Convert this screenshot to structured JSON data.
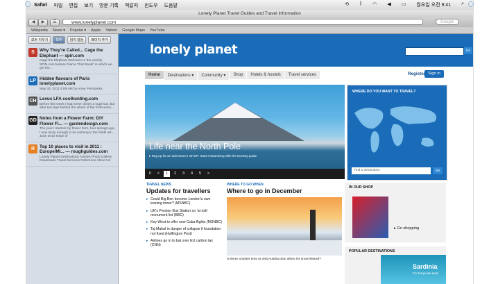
{
  "menubar": {
    "app": "Safari",
    "items": [
      "파일",
      "편집",
      "보기",
      "방문 기록",
      "책갈피",
      "윈도우",
      "도움말"
    ],
    "clock": "월요일 오전 9:41"
  },
  "window": {
    "title": "Lonely Planet Travel Guides and Travel Information"
  },
  "toolbar": {
    "url": "www.lonelyplanet.com",
    "search_placeholder": "Google"
  },
  "bookmarks": [
    "Wikipedia",
    "News ▾",
    "Popular ▾",
    "Apple",
    "Yahoo!",
    "Google Maps",
    "YouTube"
  ],
  "sidebar": {
    "tabs": [
      {
        "label": "모두 지우기"
      },
      {
        "label": "모두",
        "active": true
      },
      {
        "label": "읽지 않음"
      },
      {
        "label": "페이지 추가"
      }
    ],
    "items": [
      {
        "title": "Why They're Called... Cage the Elephant — spin.com",
        "desc": "Cage the Elephant Welcome to the weekly SPIN.com feature 'Name That Band!' in which we get the...",
        "thumb": "S",
        "color": "#c0392b"
      },
      {
        "title": "Hidden flavours of Paris lonelyplanet.com",
        "desc": "May 30, 2011 5:09 AM by Anne Petrolanka",
        "thumb": "LP",
        "color": "#1a6cb8"
      },
      {
        "title": "Lexus LFA coolhunting.com",
        "desc": "Before this week I had never driven a supercar, but after two laps behind the wheel of the forthcomin...",
        "thumb": "CH",
        "color": "#555"
      },
      {
        "title": "Notes from a Flower Farm: DIY Flower Fi... — gardendesign.com",
        "desc": "The year I started my flower farm, four springs ago, I was lucky enough to be working in the fields wit... June 2010 Issue of",
        "thumb": "GD",
        "color": "#222"
      },
      {
        "title": "Top 10 places to visit in 2011 : Europe/Mi... — roughguides.com",
        "desc": "Lonely Planet Destinations Articles Photo Gallery Downloads Travel Services Reference About Us",
        "thumb": "R",
        "color": "#e67e22"
      }
    ]
  },
  "site": {
    "logo": "lonely planet",
    "go": "Go",
    "nav": [
      "Home",
      "Destinations ▾",
      "Community ▾",
      "Shop",
      "Hotels & hostels",
      "Travel services"
    ],
    "register": "Register",
    "signin": "Sign in",
    "hero": {
      "title": "Life near the North Pole",
      "links": "▸ Rug up for an adventure   ▸ SHOP: Start researching with the Norway guide",
      "pages": [
        "II",
        "<",
        "1",
        "2",
        "3",
        "4",
        "5",
        ">"
      ]
    },
    "map": {
      "title": "WHERE DO YOU WANT TO TRAVEL?",
      "placeholder": "Find a destination",
      "go": "Go"
    },
    "news": {
      "tag": "TRAVEL NEWS",
      "title": "Updates for travellers",
      "items": [
        "Could Big Ben become London's own leaning tower? (MSNBC)",
        "UK's Preston Bus Station on 'at risk' monument list (BBC)",
        "Key West to offer new Cuba flights (MSNBC)",
        "Taj Mahal in danger of collapse if foundation not fixed (Huffington Post)",
        "Airlines go in to bat over EU carbon tax (CNN)"
      ]
    },
    "wherego": {
      "tag": "WHERE TO GO WHEN",
      "title": "Where to go in December",
      "caption": "Is there a better time to visit Austria than when it's snow-kissed?"
    },
    "shop": {
      "title": "IN OUR SHOP",
      "link": "▸ Go shopping"
    },
    "popular": {
      "title": "POPULAR DESTINATIONS",
      "place": "Sardinia",
      "sub": "For turquoise seas"
    }
  }
}
